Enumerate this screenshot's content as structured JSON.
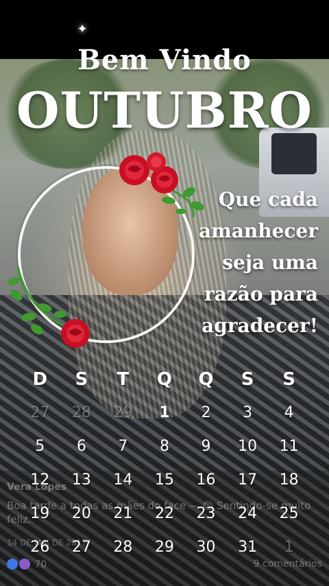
{
  "header": {
    "welcome": "Bem Vindo",
    "month": "OUTUBRO"
  },
  "quote_lines": [
    "Que cada",
    "amanhecer",
    "seja uma",
    "razão para",
    "agradecer!"
  ],
  "calendar": {
    "weekdays": [
      "D",
      "S",
      "T",
      "Q",
      "Q",
      "S",
      "S"
    ],
    "weeks": [
      [
        "27",
        "28",
        "29",
        "1",
        "2",
        "3",
        "4"
      ],
      [
        "5",
        "6",
        "7",
        "8",
        "9",
        "10",
        "11"
      ],
      [
        "12",
        "13",
        "14",
        "15",
        "16",
        "17",
        "18"
      ],
      [
        "19",
        "20",
        "21",
        "22",
        "23",
        "24",
        "25"
      ],
      [
        "26",
        "27",
        "28",
        "29",
        "30",
        "31",
        "1"
      ]
    ],
    "outside_month": [
      [
        0,
        0
      ],
      [
        0,
        1
      ],
      [
        0,
        2
      ],
      [
        4,
        6
      ]
    ],
    "highlighted": [
      [
        0,
        3
      ]
    ]
  },
  "facebook_post": {
    "author": "Vera Lopes",
    "text": "Boa tarde a todas as mães do face — 😊 Sentindo-se muito feliz.",
    "date": "14 DE MAI DE 2017",
    "reaction_count": "70",
    "comments": "9 comentários"
  },
  "colors": {
    "text": "#ffffff",
    "frame": "#ffffff",
    "rose": "#d8142a",
    "leaf": "#3f9a2f"
  },
  "icons": {
    "sparkle": "sparkle-icon",
    "rose": "rose-icon",
    "like": "like-icon",
    "love": "love-icon"
  }
}
